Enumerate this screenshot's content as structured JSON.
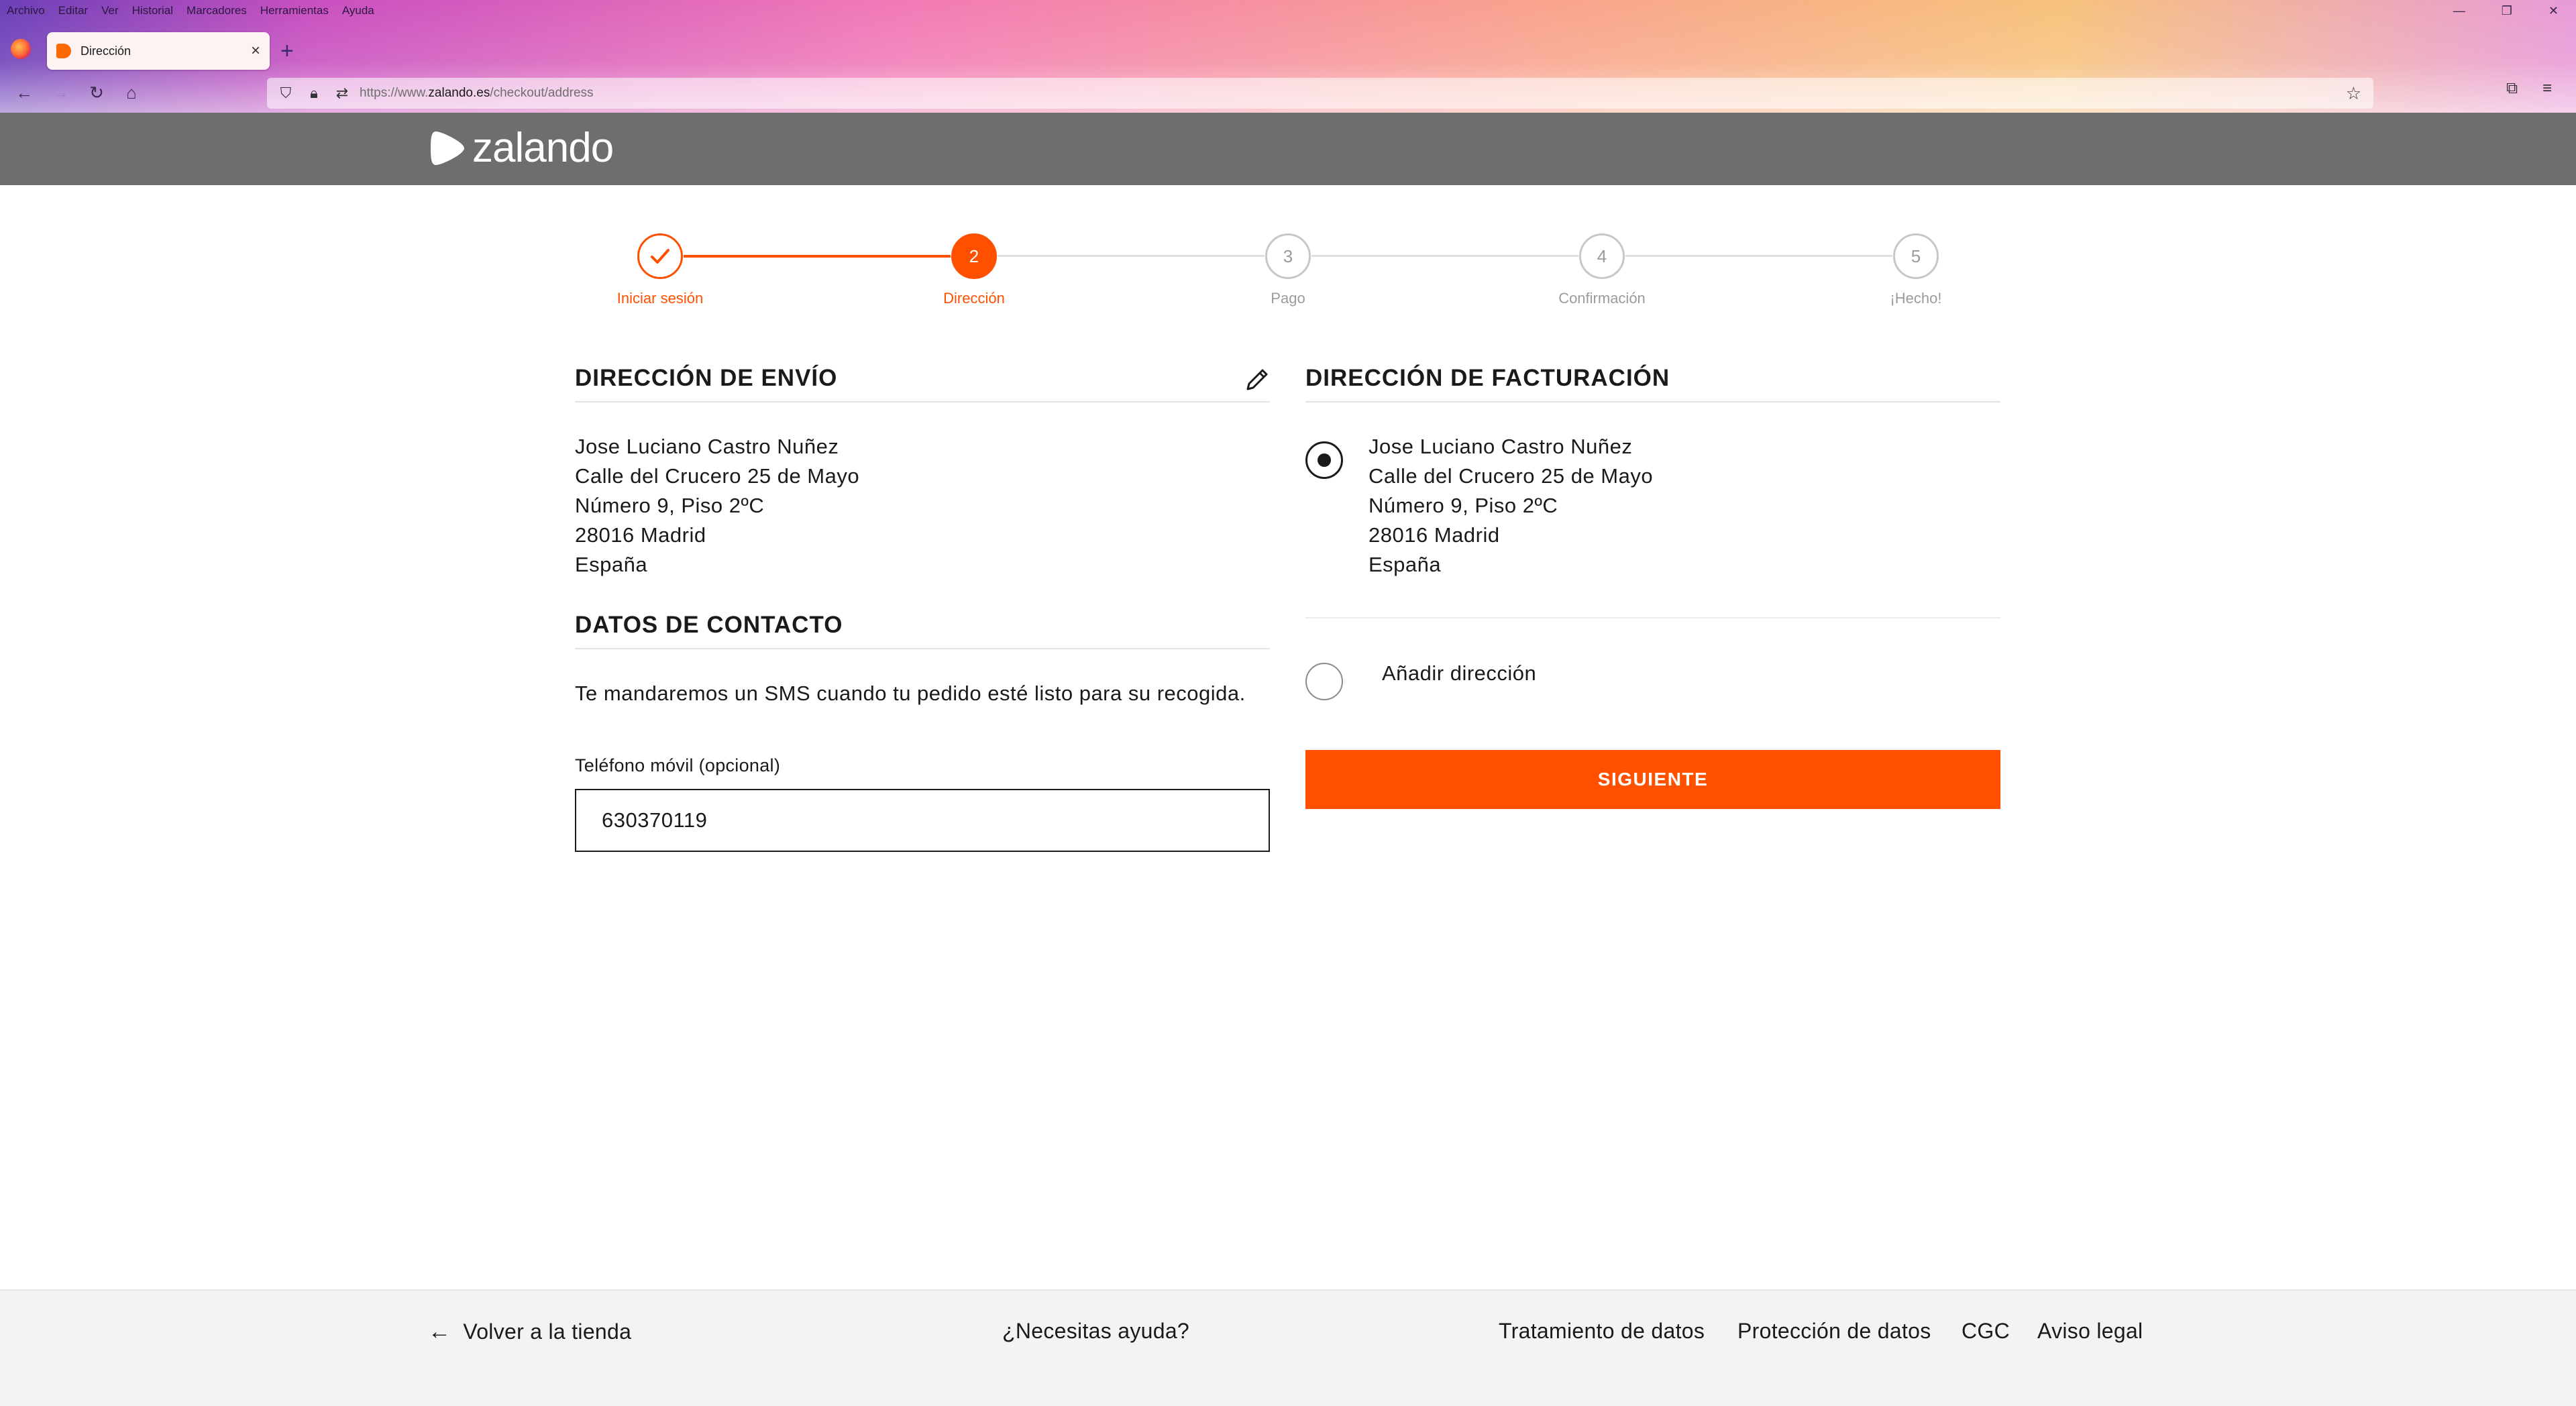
{
  "browser": {
    "menu": [
      "Archivo",
      "Editar",
      "Ver",
      "Historial",
      "Marcadores",
      "Herramientas",
      "Ayuda"
    ],
    "tab_title": "Dirección",
    "url_prefix": "https://www.",
    "url_domain": "zalando.es",
    "url_path": "/checkout/address"
  },
  "header": {
    "logo_text": "zalando"
  },
  "stepper": {
    "steps": [
      {
        "number": "✓",
        "label": "Iniciar sesión",
        "state": "done"
      },
      {
        "number": "2",
        "label": "Dirección",
        "state": "active"
      },
      {
        "number": "3",
        "label": "Pago",
        "state": "todo"
      },
      {
        "number": "4",
        "label": "Confirmación",
        "state": "todo"
      },
      {
        "number": "5",
        "label": "¡Hecho!",
        "state": "todo"
      }
    ]
  },
  "shipping": {
    "title": "DIRECCIÓN DE ENVÍO",
    "lines": [
      "Jose Luciano Castro Nuñez",
      "Calle del Crucero 25 de Mayo",
      "Número 9, Piso 2ºC",
      "28016 Madrid",
      "España"
    ]
  },
  "contact": {
    "title": "DATOS DE CONTACTO",
    "description": "Te mandaremos un SMS cuando tu pedido esté listo para su recogida.",
    "phone_label": "Teléfono móvil (opcional)",
    "phone_value": "630370119"
  },
  "billing": {
    "title": "DIRECCIÓN DE FACTURACIÓN",
    "lines": [
      "Jose Luciano Castro Nuñez",
      "Calle del Crucero 25 de Mayo",
      "Número 9, Piso 2ºC",
      "28016 Madrid",
      "España"
    ],
    "add_address_label": "Añadir dirección",
    "next_button": "SIGUIENTE"
  },
  "footer": {
    "back_link": "Volver a la tienda",
    "help_link": "¿Necesitas ayuda?",
    "data_treatment": "Tratamiento de datos",
    "data_protection": "Protección de datos",
    "terms": "CGC",
    "legal": "Aviso legal"
  },
  "colors": {
    "accent": "#ff5000",
    "header_bg": "#6e6e6e",
    "inactive": "#9b9b9b"
  }
}
